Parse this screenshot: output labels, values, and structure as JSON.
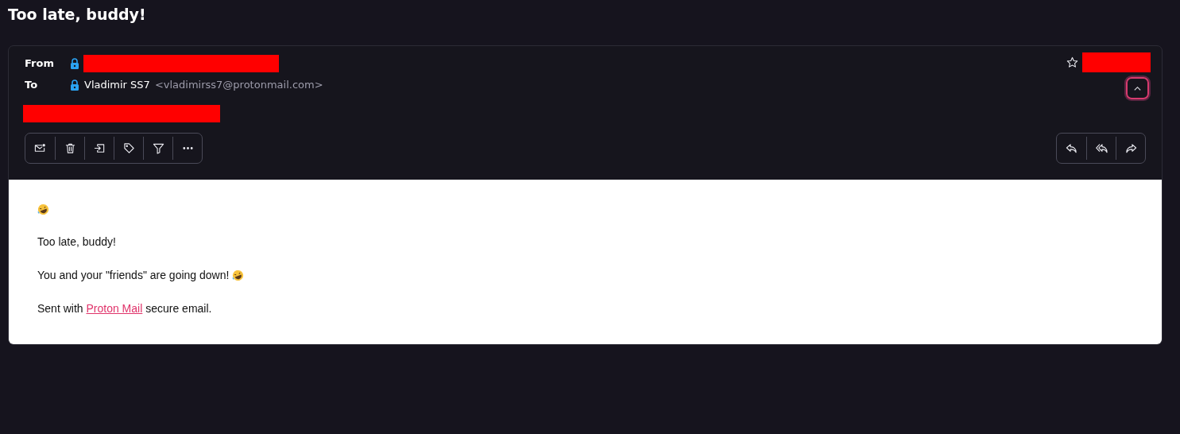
{
  "title": "Too late, buddy!",
  "header": {
    "from": {
      "label": "From",
      "redacted": true
    },
    "to": {
      "label": "To",
      "name": "Vladimir SS7",
      "address": "<vladimirss7@protonmail.com>"
    },
    "date_redacted": true,
    "labels_redacted": true,
    "starred": false,
    "expanded": true
  },
  "toolbar": [
    {
      "kind": "unread"
    },
    {
      "kind": "trash"
    },
    {
      "kind": "move"
    },
    {
      "kind": "label"
    },
    {
      "kind": "filter"
    },
    {
      "kind": "more"
    }
  ],
  "reply_actions": [
    {
      "kind": "reply"
    },
    {
      "kind": "reply_all"
    },
    {
      "kind": "forward"
    }
  ],
  "body": [
    {
      "kind": "emoji"
    },
    {
      "kind": "text",
      "text": "Too late, buddy!"
    },
    {
      "kind": "text_emoji",
      "text": "You and your \"friends\" are going down!"
    },
    {
      "kind": "signature",
      "before": "Sent with",
      "link": "Proton Mail",
      "after": "secure email."
    }
  ]
}
